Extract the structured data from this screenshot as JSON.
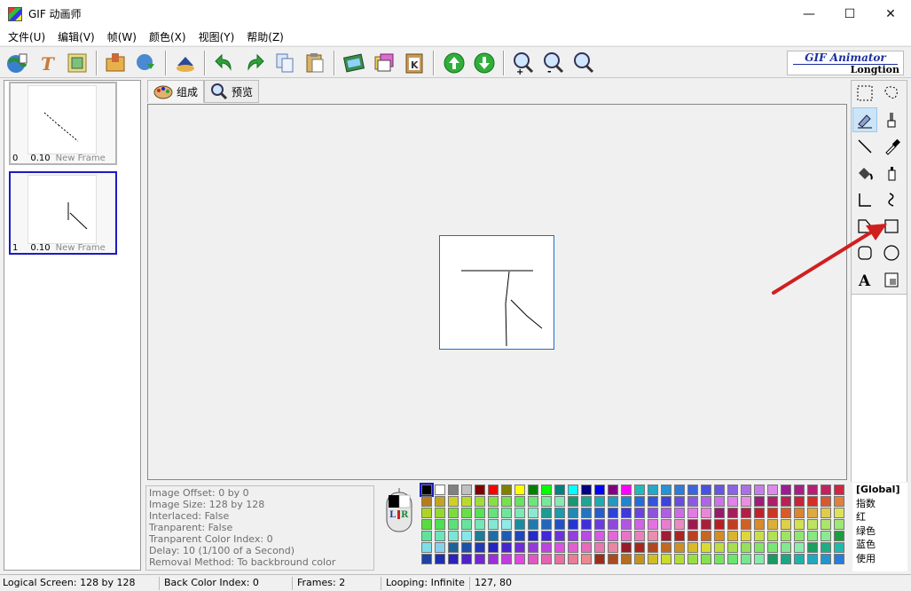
{
  "window": {
    "title": "GIF 动画师",
    "minimize": "—",
    "maximize": "☐",
    "close": "✕"
  },
  "menu": [
    "文件(U)",
    "编辑(V)",
    "帧(W)",
    "颜色(X)",
    "视图(Y)",
    "帮助(Z)"
  ],
  "logo": {
    "title": "GIF Animator",
    "subtitle": "Longtion"
  },
  "frames": [
    {
      "index": "0",
      "delay": "0.10",
      "name": "New Frame"
    },
    {
      "index": "1",
      "delay": "0.10",
      "name": "New Frame"
    }
  ],
  "tabs": {
    "compose": "组成",
    "preview": "预览"
  },
  "info": [
    "Image Offset: 0 by 0",
    "Image Size: 128 by 128",
    "Interlaced: False",
    "Tranparent: False",
    "Tranparent Color Index: 0",
    "Delay: 10 (1/100 of a Second)",
    "Removal Method: To backbround color"
  ],
  "mouse": {
    "left": "L",
    "right": "R"
  },
  "color_list": [
    "[Global]",
    "指数",
    "红",
    "绿色",
    "蓝色",
    "使用"
  ],
  "status": {
    "logical_screen": "Logical Screen: 128 by 128",
    "back_color": "Back Color Index: 0",
    "frames": "Frames: 2",
    "looping": "Looping: Infinite",
    "coords": "127, 80"
  },
  "colors": {
    "selection_border": "#1c1cc0",
    "canvas_border": "#1a6fc7",
    "annotation_arrow": "#d01f1f"
  }
}
